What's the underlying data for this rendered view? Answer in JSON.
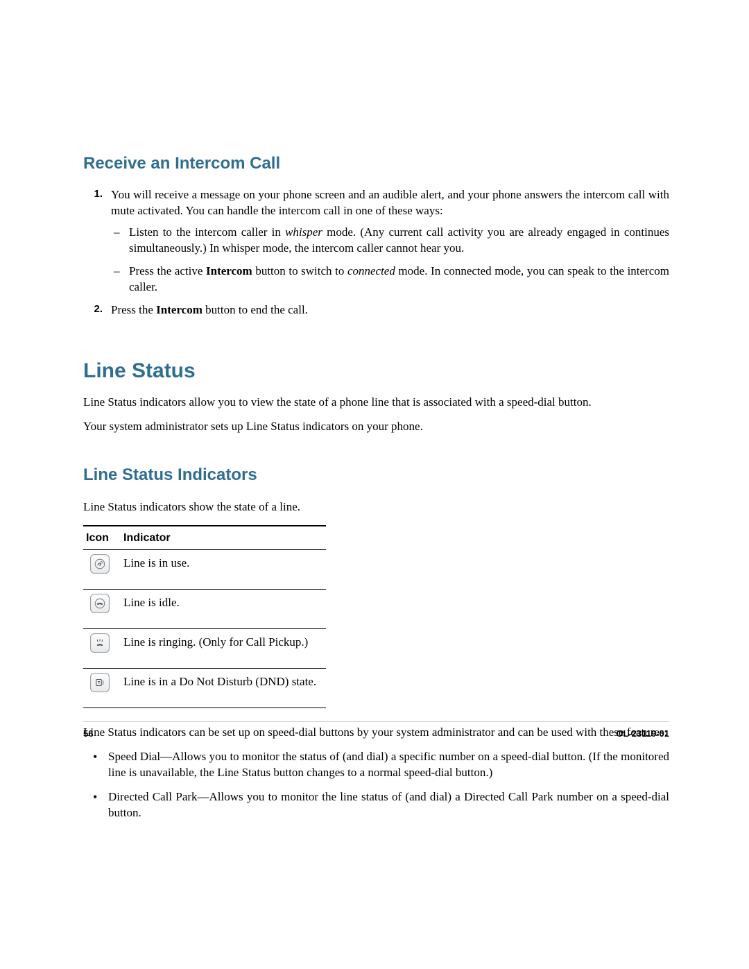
{
  "section1": {
    "heading": "Receive an Intercom Call",
    "steps": [
      {
        "num": "1.",
        "text_a": "You will receive a message on your phone screen and an audible alert, and your phone answers the intercom call with mute activated. You can handle the intercom call in one of these ways:",
        "sub": [
          {
            "pre": "Listen to the intercom caller in ",
            "em": "whisper",
            "post": " mode. (Any current call activity you are already engaged in continues simultaneously.) In whisper mode, the intercom caller cannot hear you."
          },
          {
            "pre": "Press the active ",
            "b1": "Intercom",
            "mid": " button to switch to ",
            "em": "connected",
            "post": " mode. In connected mode, you can speak to the intercom caller."
          }
        ]
      },
      {
        "num": "2.",
        "pre": "Press the ",
        "b1": "Intercom",
        "post": " button to end the call."
      }
    ]
  },
  "section2": {
    "heading": "Line Status",
    "p1": "Line Status indicators allow you to view the state of a phone line that is associated with a speed-dial button.",
    "p2": "Your system administrator sets up Line Status indicators on your phone."
  },
  "section3": {
    "heading": "Line Status Indicators",
    "intro": "Line Status indicators show the state of a line.",
    "table": {
      "head_icon": "Icon",
      "head_ind": "Indicator",
      "rows": [
        {
          "icon": "in-use",
          "text": "Line is in use."
        },
        {
          "icon": "idle",
          "text": "Line is idle."
        },
        {
          "icon": "ringing",
          "text": "Line is ringing. (Only for Call Pickup.)"
        },
        {
          "icon": "dnd",
          "text": "Line is in a Do Not Disturb (DND) state."
        }
      ]
    },
    "after": "Line Status indicators can be set up on speed-dial buttons by your system administrator and can be used with these features:",
    "bullets": [
      "Speed Dial—Allows you to monitor the status of (and dial) a specific number on a speed-dial button. (If the monitored line is unavailable, the Line Status button changes to a normal speed-dial button.)",
      "Directed Call Park—Allows you to monitor the line status of (and dial) a Directed Call Park number on a speed-dial button."
    ]
  },
  "footer": {
    "page": "56",
    "doc": "OL-23119-01"
  }
}
